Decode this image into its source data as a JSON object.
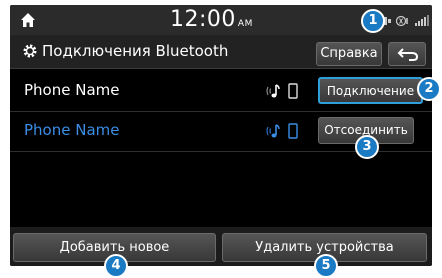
{
  "status_bar": {
    "time": "12:00",
    "ampm": "AM"
  },
  "header": {
    "title": "Подключения Bluetooth",
    "help_label": "Справка"
  },
  "devices": [
    {
      "name": "Phone Name",
      "action_label": "Подключение",
      "name_color": "#ffffff"
    },
    {
      "name": "Phone Name",
      "action_label": "Отсоединить",
      "name_color": "#3a8ee6"
    }
  ],
  "footer": {
    "add_label": "Добавить новое",
    "delete_label": "Удалить устройства"
  },
  "callouts": [
    "1",
    "2",
    "3",
    "4",
    "5"
  ],
  "colors": {
    "accent": "#1a7ac4",
    "highlight_border": "#2f9fd9",
    "connected_name": "#3a8ee6"
  }
}
